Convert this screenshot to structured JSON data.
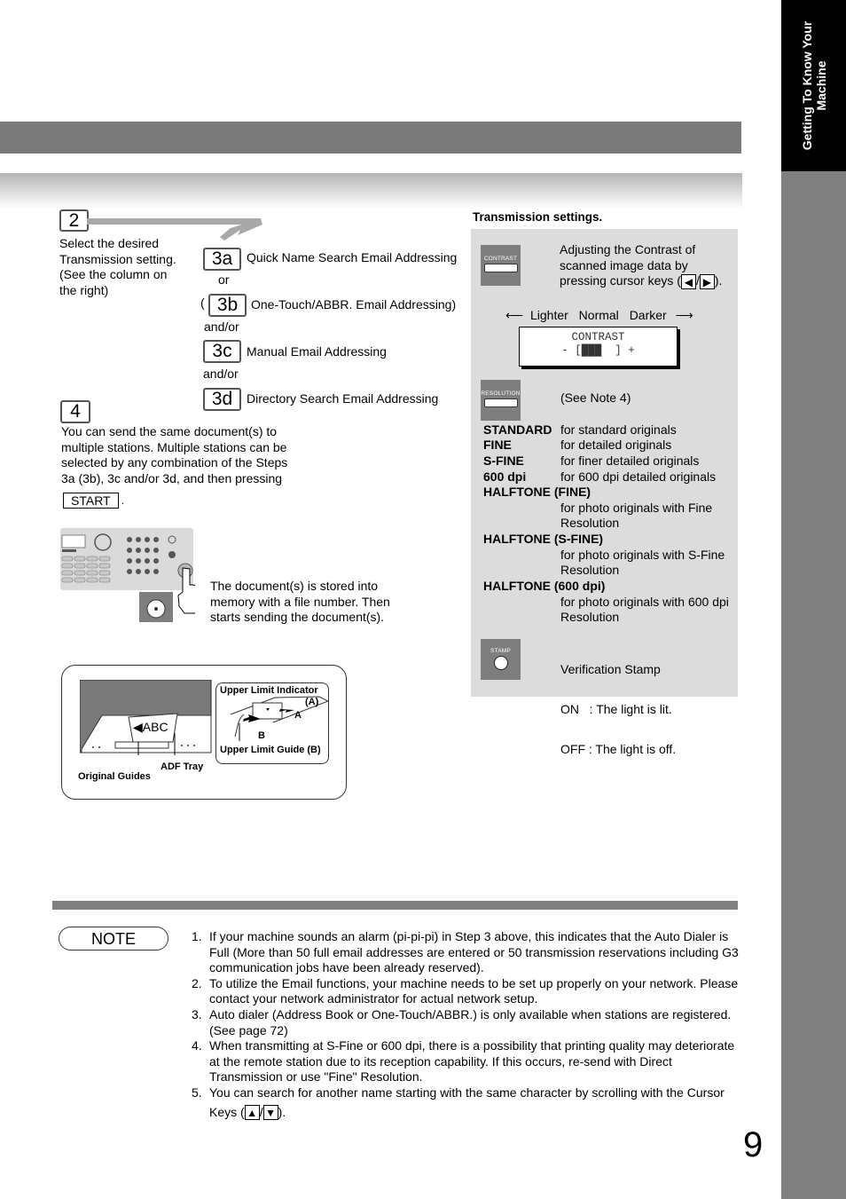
{
  "side_tab": {
    "line1": "Getting To Know Your",
    "line2": "Machine"
  },
  "step2": {
    "number": "2",
    "text": [
      "Select the  desired",
      "Transmission setting.",
      "(See the column on",
      "the right)"
    ]
  },
  "step3": [
    {
      "label": "3a",
      "text": "Quick Name Search Email Addressing",
      "prefix": "",
      "connector": "or"
    },
    {
      "label": "3b",
      "text": "One-Touch/ABBR. Email Addressing)",
      "prefix": "(",
      "connector": "and/or"
    },
    {
      "label": "3c",
      "text": "Manual Email Addressing",
      "prefix": "",
      "connector": "and/or"
    },
    {
      "label": "3d",
      "text": "Directory Search Email Addressing",
      "prefix": ""
    }
  ],
  "step4": {
    "number": "4",
    "text": [
      "You can send the same document(s) to",
      "multiple stations. Multiple stations can be",
      "selected by any combination of the Steps",
      "3a (3b), 3c and/or 3d, and then pressing"
    ],
    "start_key": "START",
    "after_key": ".",
    "stored_text": [
      "The document(s) is stored into",
      "memory with a file number. Then",
      "starts sending the document(s)."
    ],
    "panel_start_label": "START"
  },
  "adf_diagram": {
    "upper_limit_indicator": "Upper Limit Indicator",
    "indicator_paren": "(A)",
    "label_a": "A",
    "label_b": "B",
    "upper_limit_guide": "Upper Limit Guide (B)",
    "adf_tray": "ADF Tray",
    "original_guides": "Original Guides",
    "sheet_text": "ABC"
  },
  "transmission": {
    "title": "Transmission settings.",
    "contrast": {
      "key_label": "CONTRAST",
      "desc": [
        "Adjusting the Contrast of",
        "scanned image data by",
        "pressing cursor keys ("
      ],
      "desc_end": ").",
      "left_key": "◀",
      "right_key": "▶",
      "slash": "/",
      "scale": [
        "Lighter",
        "Normal",
        "Darker"
      ],
      "lcd_title": "CONTRAST",
      "lcd_minus": "-",
      "lcd_plus": "+",
      "lcd_level_blocks": 3,
      "lcd_total_blocks": 5
    },
    "resolution": {
      "key_label": "RESOLUTION",
      "note": "(See Note 4)",
      "options": [
        {
          "name": "STANDARD",
          "desc": [
            "for standard originals"
          ]
        },
        {
          "name": "FINE",
          "desc": [
            "for detailed originals"
          ]
        },
        {
          "name": "S-FINE",
          "desc": [
            "for finer detailed originals"
          ]
        },
        {
          "name": "600 dpi",
          "desc": [
            "for 600 dpi detailed originals"
          ]
        },
        {
          "name": "HALFTONE (FINE)",
          "desc": [
            "for photo originals with Fine",
            "Resolution"
          ]
        },
        {
          "name": "HALFTONE (S-FINE)",
          "desc": [
            "for photo originals with S-Fine",
            "Resolution"
          ]
        },
        {
          "name": "HALFTONE (600 dpi)",
          "desc": [
            "for photo originals with 600 dpi",
            "Resolution"
          ]
        }
      ]
    },
    "stamp": {
      "key_label": "STAMP",
      "lines": [
        "Verification Stamp",
        "ON   : The light is lit.",
        "OFF : The light is off."
      ]
    }
  },
  "note": {
    "label": "NOTE",
    "items": [
      {
        "num": "1.",
        "text": "If your machine sounds an alarm (pi-pi-pi) in Step 3 above, this indicates that the Auto Dialer is Full (More than 50 full email addresses are entered or 50 transmission reservations including G3 communication jobs have been already reserved)."
      },
      {
        "num": "2.",
        "text": "To utilize the Email functions, your machine needs to be set up properly on your network. Please contact your network administrator for actual network setup."
      },
      {
        "num": "3.",
        "text": "Auto dialer (Address Book or One-Touch/ABBR.) is only available when stations are registered. (See page 72)"
      },
      {
        "num": "4.",
        "text": "When transmitting at S-Fine or 600 dpi, there is a possibility that printing quality may deteriorate at the remote station due to its reception capability. If this occurs, re-send with Direct Transmission or use \"Fine\" Resolution."
      },
      {
        "num": "5.",
        "text": "You can search for another name starting with the same character by scrolling with the Cursor",
        "text2": "Keys (",
        "up_key": "▲",
        "slash": "/",
        "down_key": "▼",
        "end": ")."
      }
    ]
  },
  "page_number": "9"
}
